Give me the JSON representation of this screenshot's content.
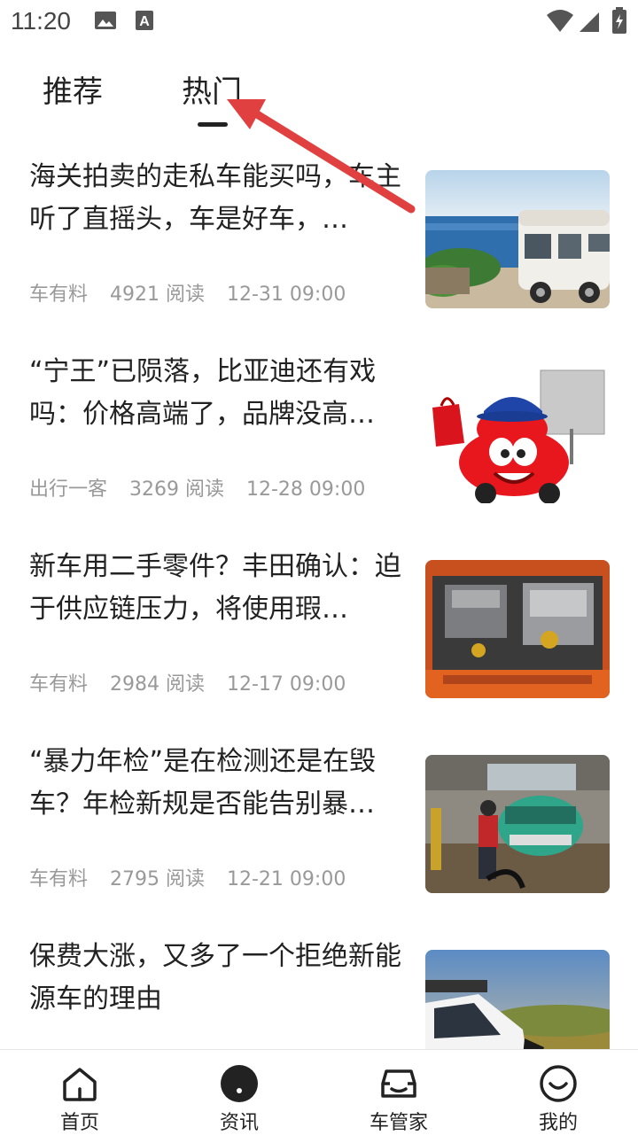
{
  "status_bar": {
    "time": "11:20"
  },
  "tabs": [
    {
      "label": "推荐",
      "active": false
    },
    {
      "label": "热门",
      "active": true
    }
  ],
  "articles": [
    {
      "title": "海关拍卖的走私车能买吗，车主听了直摇头，车是好车，…",
      "source": "车有料",
      "reads": "4921 阅读",
      "date": "12-31 09:00",
      "thumb": "motorhome"
    },
    {
      "title": "“宁王”已陨落，比亚迪还有戏吗：价格高端了，品牌没高…",
      "source": "出行一客",
      "reads": "3269 阅读",
      "date": "12-28 09:00",
      "thumb": "cartoon-car"
    },
    {
      "title": "新车用二手零件？丰田确认：迫于供应链压力，将使用瑕…",
      "source": "车有料",
      "reads": "2984 阅读",
      "date": "12-17 09:00",
      "thumb": "engine-bay"
    },
    {
      "title": "“暴力年检”是在检测还是在毁车？年检新规是否能告别暴…",
      "source": "车有料",
      "reads": "2795 阅读",
      "date": "12-21 09:00",
      "thumb": "inspection"
    },
    {
      "title": "保费大涨，又多了一个拒绝新能源车的理由",
      "source": "",
      "reads": "",
      "date": "",
      "thumb": "white-suv"
    }
  ],
  "bottom_nav": [
    {
      "label": "首页",
      "icon": "home-icon"
    },
    {
      "label": "资讯",
      "icon": "news-icon",
      "active": true
    },
    {
      "label": "车管家",
      "icon": "car-icon"
    },
    {
      "label": "我的",
      "icon": "profile-icon"
    }
  ],
  "colors": {
    "arrow": "#e0403f",
    "meta_text": "#999999",
    "text": "#222222"
  }
}
